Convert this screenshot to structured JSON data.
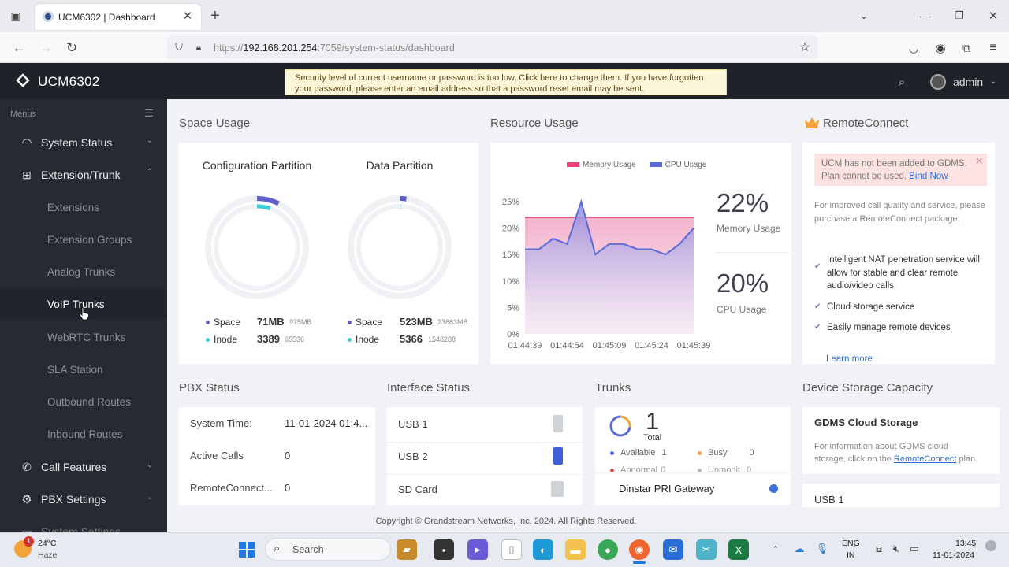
{
  "browser": {
    "tab_title": "UCM6302 | Dashboard",
    "url_prefix": "https://",
    "url_host": "192.168.201.254",
    "url_path": ":7059/system-status/dashboard"
  },
  "header": {
    "brand": "UCM6302",
    "warning": "Security level of current username or password is too low. Click here to change them. If you have forgotten your password, please enter an email address so that a password reset email may be sent.",
    "user": "admin"
  },
  "sidebar": {
    "menus_label": "Menus",
    "items": [
      {
        "label": "System Status"
      },
      {
        "label": "Extension/Trunk"
      },
      {
        "label": "Call Features"
      },
      {
        "label": "PBX Settings"
      },
      {
        "label": "System Settings"
      }
    ],
    "sub_items": [
      {
        "label": "Extensions"
      },
      {
        "label": "Extension Groups"
      },
      {
        "label": "Analog Trunks"
      },
      {
        "label": "VoIP Trunks"
      },
      {
        "label": "WebRTC Trunks"
      },
      {
        "label": "SLA Station"
      },
      {
        "label": "Outbound Routes"
      },
      {
        "label": "Inbound Routes"
      }
    ]
  },
  "space_usage": {
    "title": "Space Usage",
    "config": {
      "title": "Configuration Partition",
      "space_label": "Space",
      "space_value": "71MB",
      "space_total": "975MB",
      "inode_label": "Inode",
      "inode_value": "3389",
      "inode_total": "65536",
      "space_ratio": 0.073,
      "inode_ratio": 0.052
    },
    "data": {
      "title": "Data Partition",
      "space_label": "Space",
      "space_value": "523MB",
      "space_total": "23663MB",
      "inode_label": "Inode",
      "inode_value": "5366",
      "inode_total": "1548288",
      "space_ratio": 0.022,
      "inode_ratio": 0.0035
    }
  },
  "resource_usage": {
    "title": "Resource Usage",
    "memory_pct": "22%",
    "memory_label": "Memory Usage",
    "cpu_pct": "20%",
    "cpu_label": "CPU Usage"
  },
  "chart_data": {
    "type": "area",
    "x": [
      "01:44:39",
      "01:44:44",
      "01:44:49",
      "01:44:54",
      "01:44:59",
      "01:45:04",
      "01:45:09",
      "01:45:14",
      "01:45:19",
      "01:45:24",
      "01:45:29",
      "01:45:34",
      "01:45:39"
    ],
    "x_tick_labels": [
      "01:44:39",
      "01:44:54",
      "01:45:09",
      "01:45:24",
      "01:45:39"
    ],
    "y_tick_labels": [
      "25%",
      "20%",
      "15%",
      "10%",
      "5%",
      "0%"
    ],
    "ylim": [
      0,
      25
    ],
    "series": [
      {
        "name": "Memory Usage",
        "color": "#e0457b",
        "values": [
          22,
          22,
          22,
          22,
          22,
          22,
          22,
          22,
          22,
          22,
          22,
          22,
          22
        ]
      },
      {
        "name": "CPU Usage",
        "color": "#5b6bd6",
        "values": [
          16,
          16,
          18,
          17,
          25,
          15,
          17,
          17,
          16,
          16,
          15,
          17,
          20
        ]
      }
    ]
  },
  "remote_connect": {
    "title": "RemoteConnect",
    "alert": "UCM has not been added to GDMS. Plan cannot be used.",
    "alert_link": "Bind Now",
    "intro": "For improved call quality and service, please purchase a RemoteConnect package.",
    "features": [
      "Intelligent NAT penetration service will allow for stable and clear remote audio/video calls.",
      "Cloud storage service",
      "Easily manage remote devices"
    ],
    "learn_more": "Learn more"
  },
  "pbx_status": {
    "title": "PBX Status",
    "rows": [
      {
        "label": "System Time:",
        "value": "11-01-2024 01:4..."
      },
      {
        "label": "Active Calls",
        "value": "0"
      },
      {
        "label": "RemoteConnect...",
        "value": "0"
      }
    ]
  },
  "interface_status": {
    "title": "Interface Status",
    "rows": [
      {
        "label": "USB 1"
      },
      {
        "label": "USB 2"
      },
      {
        "label": "SD Card"
      }
    ]
  },
  "trunks": {
    "title": "Trunks",
    "total": "1",
    "total_label": "Total",
    "available_label": "Available",
    "available": "1",
    "busy_label": "Busy",
    "busy": "0",
    "abnormal_label": "Abnormal",
    "abnormal": "0",
    "unmonit_label": "Unmonit",
    "unmonit": "0",
    "trunk_name": "Dinstar PRI Gateway"
  },
  "device_storage": {
    "title": "Device Storage Capacity",
    "gdms_title": "GDMS Cloud Storage",
    "gdms_text": "For information about GDMS cloud storage, click on the",
    "gdms_link": "RemoteConnect",
    "gdms_tail": "plan.",
    "usb_title": "USB 1"
  },
  "footer": {
    "copyright": "Copyright © Grandstream Networks, Inc. 2024. All Rights Reserved."
  },
  "taskbar": {
    "weather_temp": "24°C",
    "weather_desc": "Haze",
    "weather_badge": "1",
    "search": "Search",
    "lang1": "ENG",
    "lang2": "IN",
    "time": "13:45",
    "date": "11-01-2024"
  }
}
